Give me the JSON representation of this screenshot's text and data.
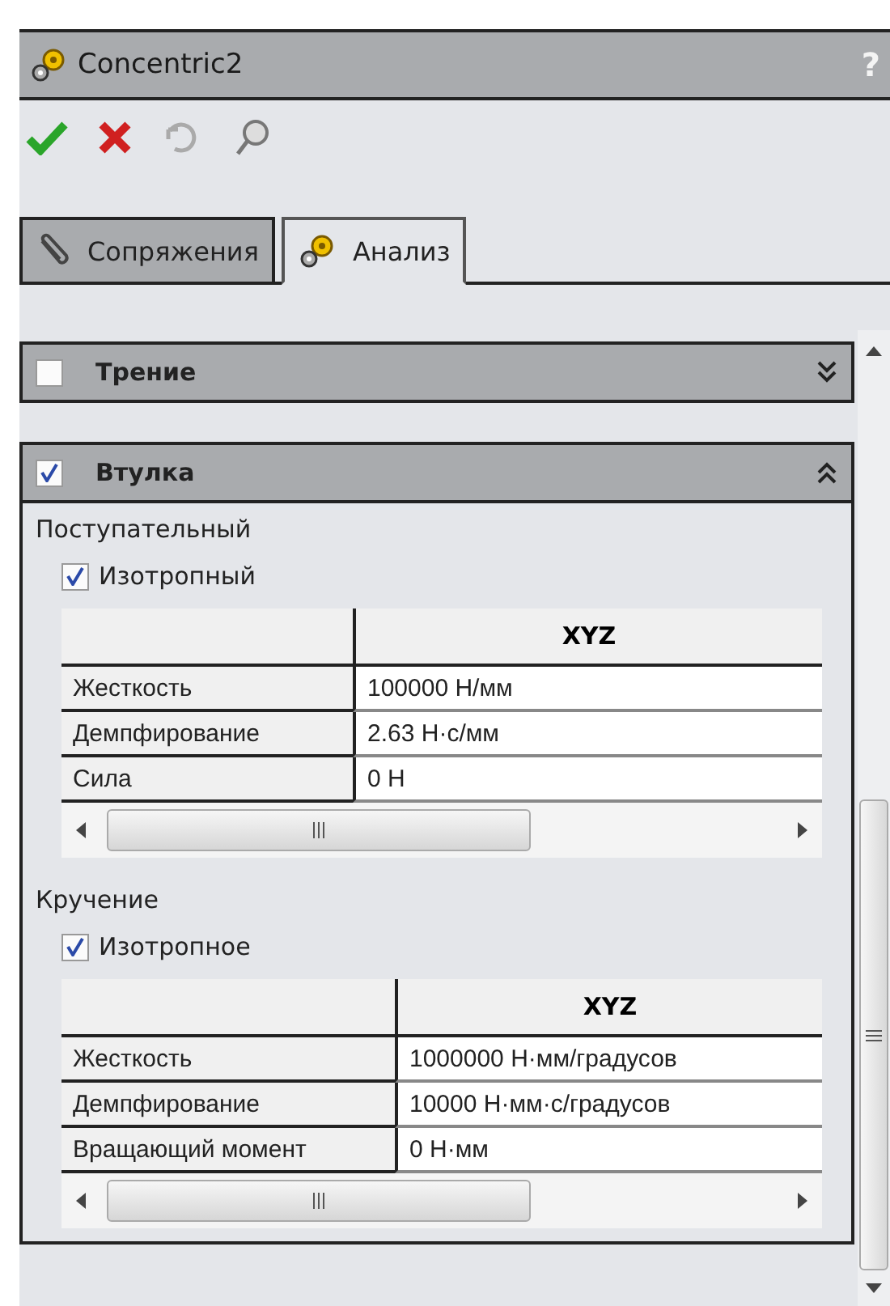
{
  "window": {
    "title": "Concentric2",
    "help": "?"
  },
  "tabs": [
    {
      "label": "Сопряжения",
      "selected": false,
      "kind": "clip"
    },
    {
      "label": "Анализ",
      "selected": true,
      "kind": "gear"
    }
  ],
  "sections": [
    {
      "title": "Трение",
      "checked": false,
      "expanded": false
    },
    {
      "title": "Втулка",
      "checked": true,
      "expanded": true,
      "groups": [
        {
          "title": "Поступательный",
          "option": {
            "label": "Изотропный",
            "checked": true
          },
          "table": {
            "header": "XYZ",
            "rows": [
              {
                "label": "Жесткость",
                "value": "100000 Н/мм"
              },
              {
                "label": "Демпфирование",
                "value": "2.63 Н·с/мм"
              },
              {
                "label": "Сила",
                "value": "0 Н"
              }
            ]
          }
        },
        {
          "title": "Кручение",
          "option": {
            "label": "Изотропное",
            "checked": true
          },
          "table": {
            "header": "XYZ",
            "rows": [
              {
                "label": "Жесткость",
                "value": "1000000 Н·мм/градусов"
              },
              {
                "label": "Демпфирование",
                "value": "10000 Н·мм·с/градусов"
              },
              {
                "label": "Вращающий момент",
                "value": "0 Н·мм"
              }
            ]
          }
        }
      ]
    }
  ]
}
